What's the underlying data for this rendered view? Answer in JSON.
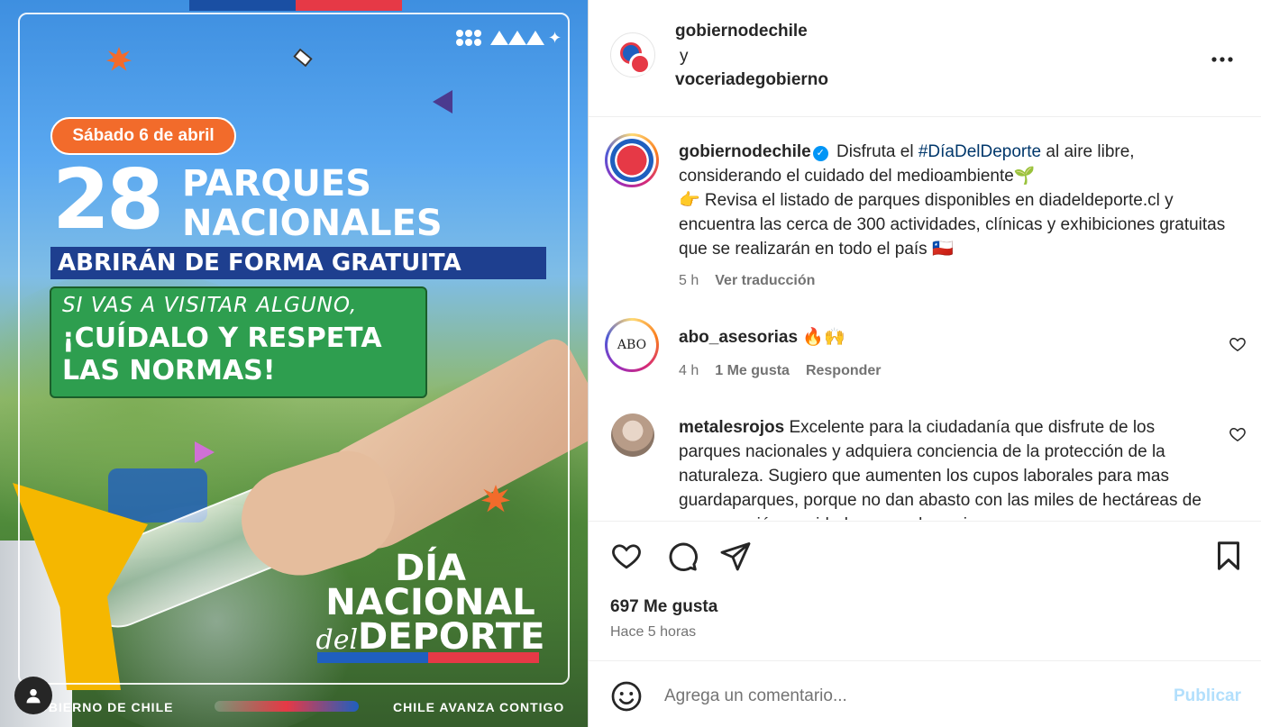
{
  "post_image": {
    "date_pill": "Sábado 6 de abril",
    "big_number": "28",
    "parques_line1": "PARQUES",
    "parques_line2": "NACIONALES",
    "banner": "ABRIRÁN DE FORMA GRATUITA",
    "green_line1": "SI VAS A VISITAR ALGUNO,",
    "green_line2": "¡CUÍDALO Y RESPETA",
    "green_line3": "LAS NORMAS!",
    "dia_line1": "DÍA",
    "dia_line2": "NACIONAL",
    "dia_line3_small": "del",
    "dia_line3_big": "DEPORTE",
    "footer_left": "GOBIERNO DE CHILE",
    "footer_right": "CHILE AVANZA CONTIGO",
    "colors": {
      "orange": "#f26b2b",
      "navy": "#1e3f8f",
      "green": "#2e9e4f",
      "red": "#e63946",
      "blue": "#1f5fbf"
    }
  },
  "header": {
    "author1": "gobiernodechile",
    "conjunction": "y",
    "author2": "voceriadegobierno",
    "more_icon": "more-horizontal-icon"
  },
  "caption": {
    "username": "gobiernodechile",
    "text_before_tag": " Disfruta el ",
    "hashtag": "#DíaDelDeporte",
    "text_after_tag": " al aire libre, considerando el cuidado del medioambiente🌱",
    "text_line2": "👉 Revisa el listado de parques disponibles en diadeldeporte.cl y encuentra las cerca de 300 actividades, clínicas y exhibiciones gratuitas que se realizarán en todo el país 🇨🇱",
    "time": "5 h",
    "translate": "Ver traducción"
  },
  "comments": [
    {
      "username": "abo_asesorias",
      "text": " 🔥🙌",
      "avatar_text": "ABO",
      "time": "4 h",
      "likes": "1 Me gusta",
      "reply": "Responder"
    },
    {
      "username": "metalesrojos",
      "text": " Excelente para la ciudadanía que disfrute de los parques nacionales y adquiera conciencia de la protección de la naturaleza. Sugiero que aumenten los cupos laborales para mas guardaparques, porque no dan abasto con las miles de hectáreas de conservación y cuidado que se les exige."
    }
  ],
  "actions": {
    "likes": "697 Me gusta",
    "time_ago": "Hace 5 horas"
  },
  "composer": {
    "placeholder": "Agrega un comentario...",
    "publish": "Publicar"
  }
}
